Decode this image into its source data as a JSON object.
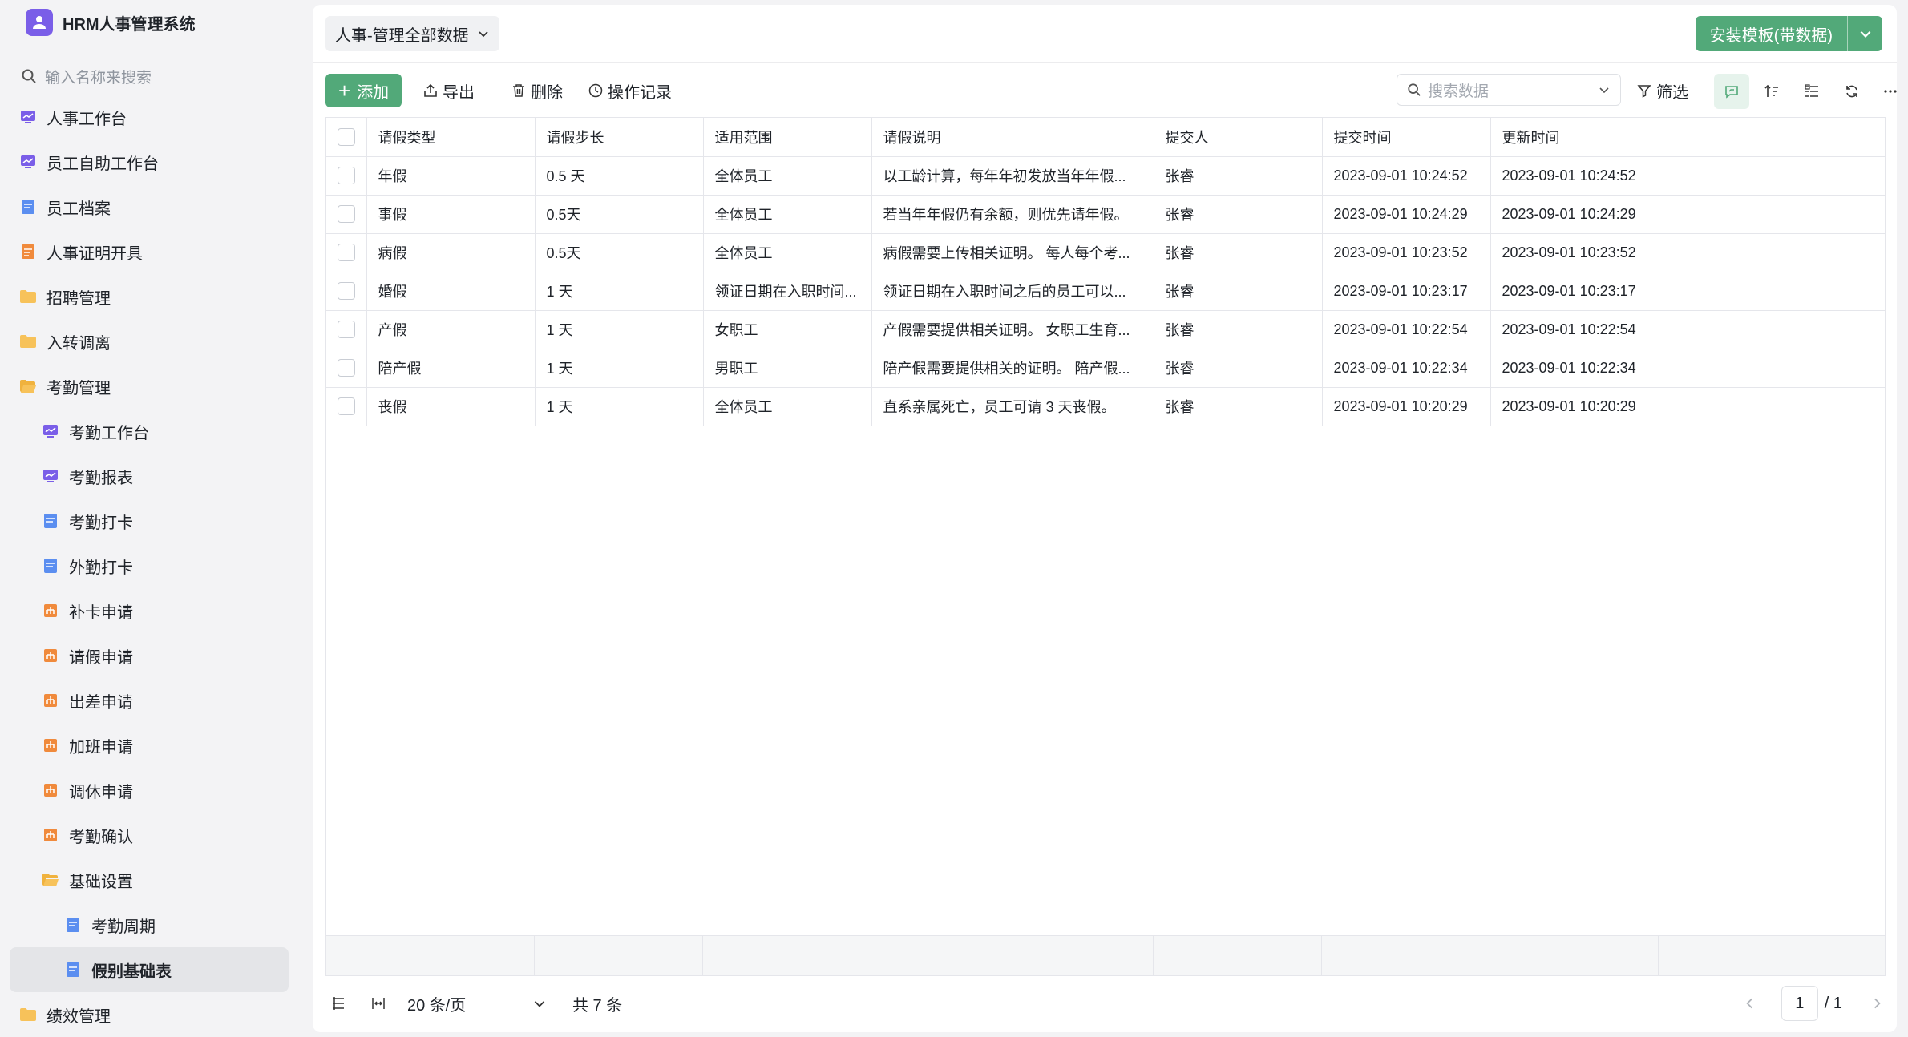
{
  "app": {
    "title": "HRM人事管理系统"
  },
  "sidebar": {
    "search_placeholder": "输入名称来搜索",
    "items": [
      {
        "label": "人事工作台",
        "icon": "dashboard-icon",
        "level": 0
      },
      {
        "label": "员工自助工作台",
        "icon": "dashboard-icon",
        "level": 0
      },
      {
        "label": "员工档案",
        "icon": "form-icon",
        "level": 0
      },
      {
        "label": "人事证明开具",
        "icon": "document-icon",
        "level": 0
      },
      {
        "label": "招聘管理",
        "icon": "folder-icon",
        "level": 0
      },
      {
        "label": "入转调离",
        "icon": "folder-icon",
        "level": 0
      },
      {
        "label": "考勤管理",
        "icon": "folder-open-icon",
        "level": 0
      },
      {
        "label": "考勤工作台",
        "icon": "dashboard-icon",
        "level": 1
      },
      {
        "label": "考勤报表",
        "icon": "dashboard-icon",
        "level": 1
      },
      {
        "label": "考勤打卡",
        "icon": "form-icon",
        "level": 1
      },
      {
        "label": "外勤打卡",
        "icon": "form-icon",
        "level": 1
      },
      {
        "label": "补卡申请",
        "icon": "process-icon",
        "level": 1
      },
      {
        "label": "请假申请",
        "icon": "process-icon",
        "level": 1
      },
      {
        "label": "出差申请",
        "icon": "process-icon",
        "level": 1
      },
      {
        "label": "加班申请",
        "icon": "process-icon",
        "level": 1
      },
      {
        "label": "调休申请",
        "icon": "process-icon",
        "level": 1
      },
      {
        "label": "考勤确认",
        "icon": "process-icon",
        "level": 1
      },
      {
        "label": "基础设置",
        "icon": "folder-open-icon",
        "level": 1
      },
      {
        "label": "考勤周期",
        "icon": "form-icon",
        "level": 2
      },
      {
        "label": "假别基础表",
        "icon": "form-icon",
        "level": 2,
        "active": true
      },
      {
        "label": "绩效管理",
        "icon": "folder-icon",
        "level": 0
      }
    ]
  },
  "header": {
    "view_label": "人事-管理全部数据",
    "install_label": "安装模板(带数据)"
  },
  "toolbar": {
    "add_label": "添加",
    "export_label": "导出",
    "delete_label": "删除",
    "log_label": "操作记录",
    "search_placeholder": "搜索数据",
    "filter_label": "筛选"
  },
  "table": {
    "columns": [
      "请假类型",
      "请假步长",
      "适用范围",
      "请假说明",
      "提交人",
      "提交时间",
      "更新时间"
    ],
    "rows": [
      [
        "年假",
        "0.5 天",
        "全体员工",
        "以工龄计算，每年年初发放当年年假...",
        "张睿",
        "2023-09-01 10:24:52",
        "2023-09-01 10:24:52"
      ],
      [
        "事假",
        "0.5天",
        "全体员工",
        "若当年年假仍有余额，则优先请年假。",
        "张睿",
        "2023-09-01 10:24:29",
        "2023-09-01 10:24:29"
      ],
      [
        "病假",
        "0.5天",
        "全体员工",
        "病假需要上传相关证明。 每人每个考...",
        "张睿",
        "2023-09-01 10:23:52",
        "2023-09-01 10:23:52"
      ],
      [
        "婚假",
        "1 天",
        "领证日期在入职时间...",
        "领证日期在入职时间之后的员工可以...",
        "张睿",
        "2023-09-01 10:23:17",
        "2023-09-01 10:23:17"
      ],
      [
        "产假",
        "1 天",
        "女职工",
        "产假需要提供相关证明。 女职工生育...",
        "张睿",
        "2023-09-01 10:22:54",
        "2023-09-01 10:22:54"
      ],
      [
        "陪产假",
        "1 天",
        "男职工",
        "陪产假需要提供相关的证明。 陪产假...",
        "张睿",
        "2023-09-01 10:22:34",
        "2023-09-01 10:22:34"
      ],
      [
        "丧假",
        "1 天",
        "全体员工",
        "直系亲属死亡，员工可请 3 天丧假。",
        "张睿",
        "2023-09-01 10:20:29",
        "2023-09-01 10:20:29"
      ]
    ]
  },
  "pager": {
    "page_size": "20 条/页",
    "total": "共 7 条",
    "current": "1",
    "pages": "/ 1"
  },
  "colors": {
    "accent": "#52a979",
    "logo": "#7a5ee8"
  }
}
